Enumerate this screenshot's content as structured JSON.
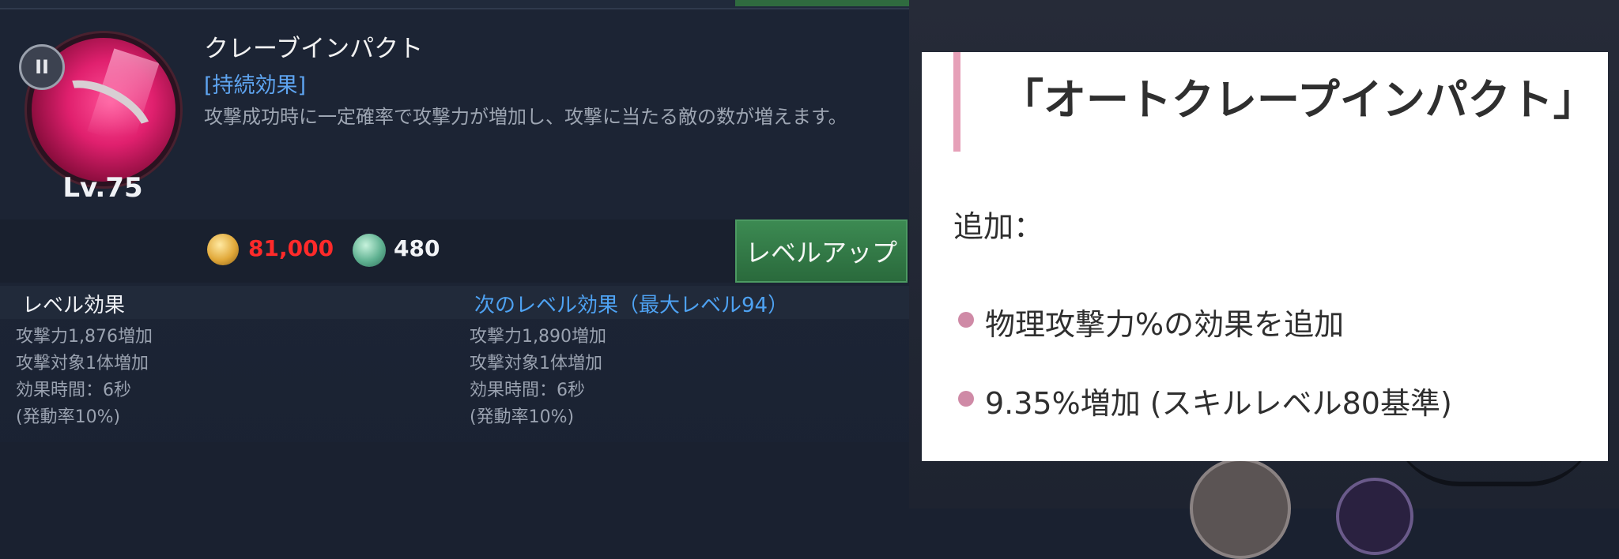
{
  "skill": {
    "name": "クレーブインパクト",
    "effect_tag": "[持続効果]",
    "description": "攻撃成功時に一定確率で攻撃力が増加し、攻撃に当たる敵の数が増えます。",
    "level": "Lv.75",
    "pause_glyph": "II"
  },
  "cost": {
    "gold": "81,000",
    "gem": "480",
    "gold_color": "#ff2a2a"
  },
  "buttons": {
    "level_up": "レベルアップ"
  },
  "effects": {
    "current_heading": "レベル効果",
    "next_heading": "次のレベル効果（最大レベル94）",
    "current_lines": [
      "攻撃力1,876増加",
      "攻撃対象1体増加",
      "効果時間：6秒",
      "(発動率10%)"
    ],
    "next_lines": [
      "攻撃力1,890増加",
      "攻撃対象1体増加",
      "効果時間：6秒",
      "(発動率10%)"
    ]
  },
  "info_card": {
    "title": "「オートクレープインパクト」",
    "add_label": "追加：",
    "bullets": [
      "物理攻撃力%の効果を追加",
      "9.35%増加 (スキルレベル80基準)"
    ],
    "accent_color": "#e6a0b8",
    "bullet_color": "#cf8aa6"
  },
  "icons": {
    "skill": "skill-orb-icon",
    "pause": "pause-icon",
    "gold": "gold-coin-icon",
    "gem": "green-gem-icon"
  }
}
